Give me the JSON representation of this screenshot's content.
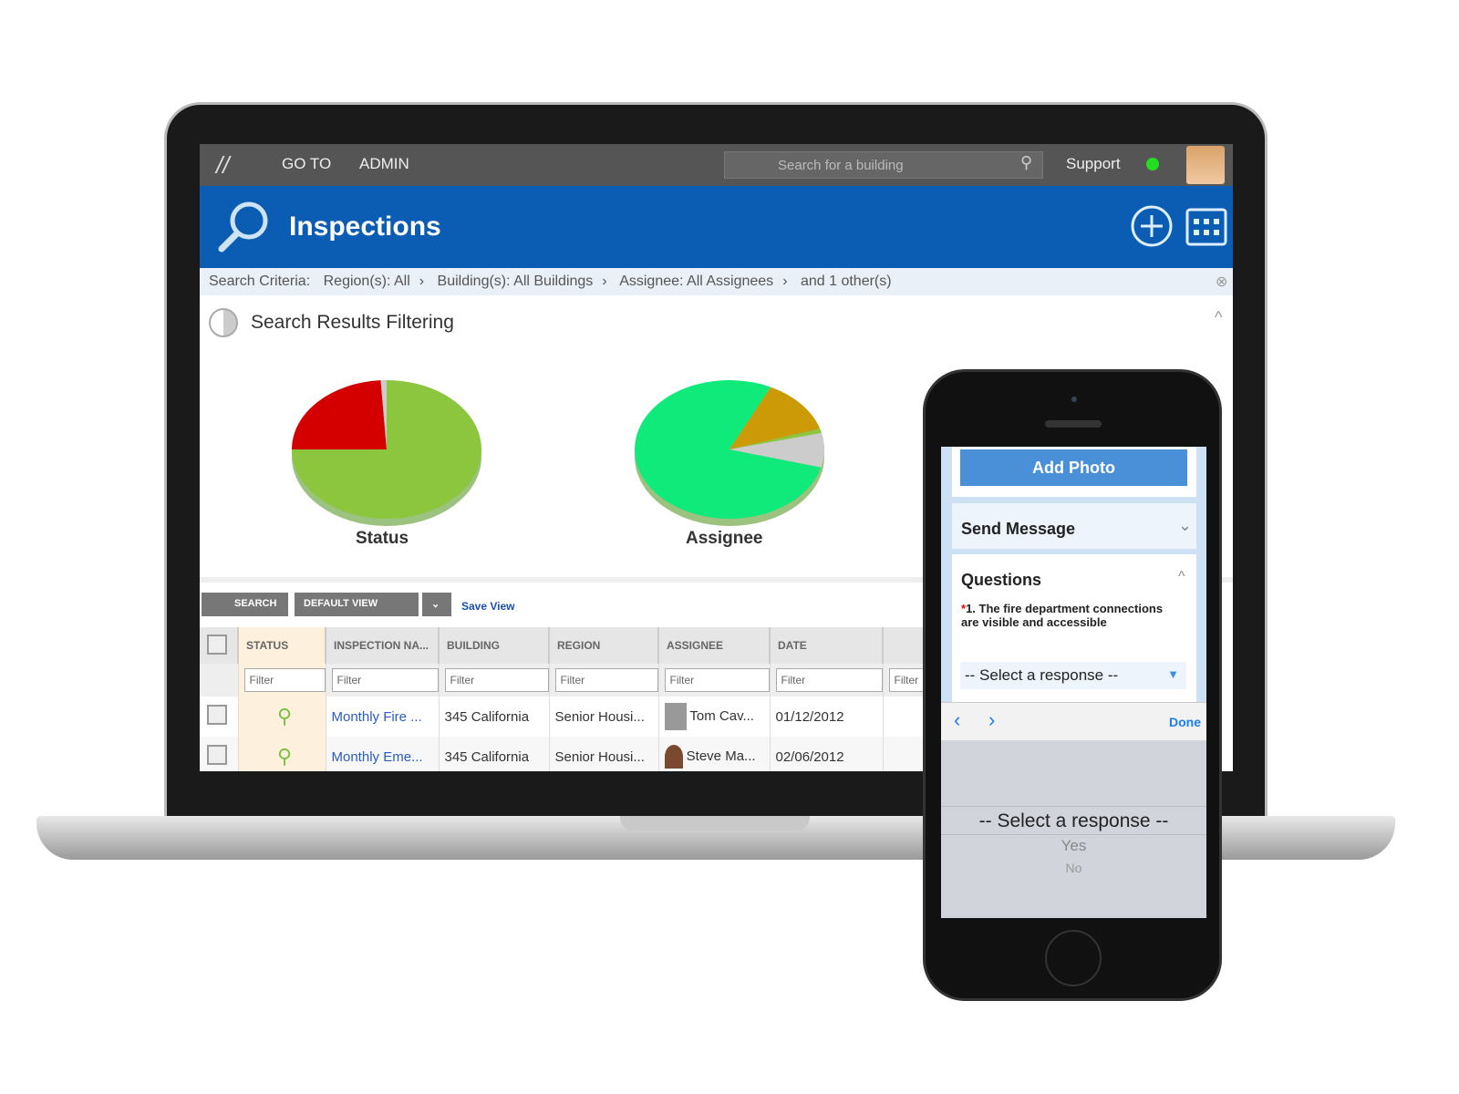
{
  "topbar": {
    "goto": "GO TO",
    "admin": "ADMIN",
    "search_placeholder": "Search for a building",
    "support": "Support",
    "status_color": "#22dd22"
  },
  "header": {
    "title": "Inspections",
    "icons": [
      "search-icon",
      "add-circle-icon",
      "calendar-icon"
    ]
  },
  "breadcrumb": {
    "label": "Search Criteria:",
    "items": [
      "Region(s): All",
      "Building(s): All Buildings",
      "Assignee: All Assignees",
      "and 1 other(s)"
    ]
  },
  "filtering": {
    "title": "Search Results Filtering"
  },
  "chart_data": [
    {
      "type": "pie",
      "title": "Status",
      "slices": [
        {
          "value": 75,
          "color": "#8cc63f"
        },
        {
          "value": 24,
          "color": "#d40000"
        },
        {
          "value": 1,
          "color": "#cccccc"
        }
      ]
    },
    {
      "type": "pie",
      "title": "Assignee",
      "slices": [
        {
          "value": 78,
          "color": "#10ea7a"
        },
        {
          "value": 13,
          "color": "#cc9a06"
        },
        {
          "value": 1,
          "color": "#8cc63f"
        },
        {
          "value": 8,
          "color": "#cccccc"
        }
      ]
    }
  ],
  "toolbar": {
    "search": "SEARCH",
    "default_view": "DEFAULT VIEW",
    "save_view": "Save View"
  },
  "table": {
    "columns": [
      "STATUS",
      "INSPECTION NA...",
      "BUILDING",
      "REGION",
      "ASSIGNEE",
      "DATE",
      ""
    ],
    "filter_placeholder": "Filter",
    "rows": [
      {
        "name": "Monthly Fire ...",
        "building": "345 California",
        "region": "Senior Housi...",
        "assignee": "Tom Cav...",
        "date": "01/12/2012"
      },
      {
        "name": "Monthly Eme...",
        "building": "345 California",
        "region": "Senior Housi...",
        "assignee": "Steve Ma...",
        "date": "02/06/2012"
      }
    ]
  },
  "phone": {
    "add_photo": "Add Photo",
    "send_message": "Send Message",
    "questions": "Questions",
    "question_number": "1.",
    "question": "The fire department connections are visible and accessible",
    "select_value": "-- Select a response --",
    "done": "Done",
    "picker_options": [
      "-- Select a response --",
      "Yes",
      "No"
    ]
  }
}
